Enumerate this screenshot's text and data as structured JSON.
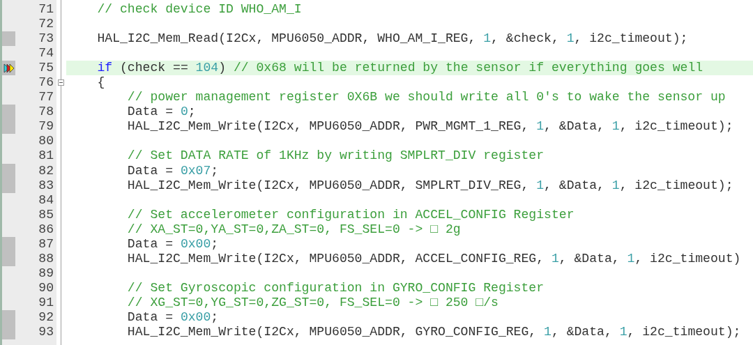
{
  "editor": {
    "lines": [
      {
        "number": "71",
        "executed": false,
        "current": false,
        "tokens": [
          {
            "kind": "comment",
            "text": "    // check device ID WHO_AM_I"
          }
        ]
      },
      {
        "number": "72",
        "executed": false,
        "current": false
      },
      {
        "number": "73",
        "executed": true,
        "current": false,
        "tokens": [
          {
            "kind": "plain",
            "text": "    HAL_I2C_Mem_Read(I2Cx, MPU6050_ADDR, WHO_AM_I_REG, "
          },
          {
            "kind": "number",
            "text": "1"
          },
          {
            "kind": "plain",
            "text": ", &check, "
          },
          {
            "kind": "number",
            "text": "1"
          },
          {
            "kind": "plain",
            "text": ", i2c_timeout);"
          }
        ]
      },
      {
        "number": "74",
        "executed": false,
        "current": false
      },
      {
        "number": "75",
        "executed": true,
        "current": true,
        "tokens": [
          {
            "kind": "keyword",
            "text": "    if"
          },
          {
            "kind": "plain",
            "text": " (check == "
          },
          {
            "kind": "number",
            "text": "104"
          },
          {
            "kind": "plain",
            "text": ") "
          },
          {
            "kind": "comment",
            "text": "// 0x68 will be returned by the sensor if everything goes well"
          }
        ]
      },
      {
        "number": "76",
        "executed": false,
        "current": false,
        "expanded": true,
        "tokens": [
          {
            "kind": "plain",
            "text": "    {"
          }
        ]
      },
      {
        "number": "77",
        "executed": false,
        "current": false,
        "tokens": [
          {
            "kind": "comment",
            "text": "        // power management register 0X6B we should write all 0's to wake the sensor up"
          }
        ]
      },
      {
        "number": "78",
        "executed": true,
        "current": false,
        "tokens": [
          {
            "kind": "plain",
            "text": "        Data = "
          },
          {
            "kind": "number",
            "text": "0"
          },
          {
            "kind": "plain",
            "text": ";"
          }
        ]
      },
      {
        "number": "79",
        "executed": true,
        "current": false,
        "tokens": [
          {
            "kind": "plain",
            "text": "        HAL_I2C_Mem_Write(I2Cx, MPU6050_ADDR, PWR_MGMT_1_REG, "
          },
          {
            "kind": "number",
            "text": "1"
          },
          {
            "kind": "plain",
            "text": ", &Data, "
          },
          {
            "kind": "number",
            "text": "1"
          },
          {
            "kind": "plain",
            "text": ", i2c_timeout);"
          }
        ]
      },
      {
        "number": "80",
        "executed": false,
        "current": false
      },
      {
        "number": "81",
        "executed": false,
        "current": false,
        "tokens": [
          {
            "kind": "comment",
            "text": "        // Set DATA RATE of 1KHz by writing SMPLRT_DIV register"
          }
        ]
      },
      {
        "number": "82",
        "executed": true,
        "current": false,
        "tokens": [
          {
            "kind": "plain",
            "text": "        Data = "
          },
          {
            "kind": "number",
            "text": "0x07"
          },
          {
            "kind": "plain",
            "text": ";"
          }
        ]
      },
      {
        "number": "83",
        "executed": true,
        "current": false,
        "tokens": [
          {
            "kind": "plain",
            "text": "        HAL_I2C_Mem_Write(I2Cx, MPU6050_ADDR, SMPLRT_DIV_REG, "
          },
          {
            "kind": "number",
            "text": "1"
          },
          {
            "kind": "plain",
            "text": ", &Data, "
          },
          {
            "kind": "number",
            "text": "1"
          },
          {
            "kind": "plain",
            "text": ", i2c_timeout);"
          }
        ]
      },
      {
        "number": "84",
        "executed": false,
        "current": false
      },
      {
        "number": "85",
        "executed": false,
        "current": false,
        "tokens": [
          {
            "kind": "comment",
            "text": "        // Set accelerometer configuration in ACCEL_CONFIG Register"
          }
        ]
      },
      {
        "number": "86",
        "executed": false,
        "current": false,
        "tokens": [
          {
            "kind": "comment",
            "text": "        // XA_ST=0,YA_ST=0,ZA_ST=0, FS_SEL=0 -> □ 2g"
          }
        ]
      },
      {
        "number": "87",
        "executed": true,
        "current": false,
        "tokens": [
          {
            "kind": "plain",
            "text": "        Data = "
          },
          {
            "kind": "number",
            "text": "0x00"
          },
          {
            "kind": "plain",
            "text": ";"
          }
        ]
      },
      {
        "number": "88",
        "executed": true,
        "current": false,
        "tokens": [
          {
            "kind": "plain",
            "text": "        HAL_I2C_Mem_Write(I2Cx, MPU6050_ADDR, ACCEL_CONFIG_REG, "
          },
          {
            "kind": "number",
            "text": "1"
          },
          {
            "kind": "plain",
            "text": ", &Data, "
          },
          {
            "kind": "number",
            "text": "1"
          },
          {
            "kind": "plain",
            "text": ", i2c_timeout)"
          }
        ]
      },
      {
        "number": "89",
        "executed": false,
        "current": false
      },
      {
        "number": "90",
        "executed": false,
        "current": false,
        "tokens": [
          {
            "kind": "comment",
            "text": "        // Set Gyroscopic configuration in GYRO_CONFIG Register"
          }
        ]
      },
      {
        "number": "91",
        "executed": false,
        "current": false,
        "tokens": [
          {
            "kind": "comment",
            "text": "        // XG_ST=0,YG_ST=0,ZG_ST=0, FS_SEL=0 -> □ 250 □/s"
          }
        ]
      },
      {
        "number": "92",
        "executed": true,
        "current": false,
        "tokens": [
          {
            "kind": "plain",
            "text": "        Data = "
          },
          {
            "kind": "number",
            "text": "0x00"
          },
          {
            "kind": "plain",
            "text": ";"
          }
        ]
      },
      {
        "number": "93",
        "executed": true,
        "current": false,
        "tokens": [
          {
            "kind": "plain",
            "text": "        HAL_I2C_Mem_Write(I2Cx, MPU6050_ADDR, GYRO_CONFIG_REG, "
          },
          {
            "kind": "number",
            "text": "1"
          },
          {
            "kind": "plain",
            "text": ", &Data, "
          },
          {
            "kind": "number",
            "text": "1"
          },
          {
            "kind": "plain",
            "text": ", i2c_timeout);"
          }
        ]
      }
    ]
  }
}
